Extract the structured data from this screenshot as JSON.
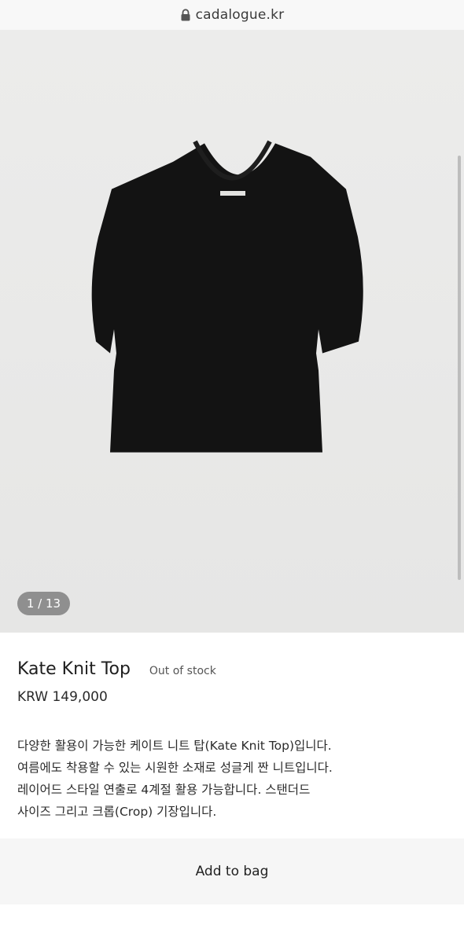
{
  "browser": {
    "url": "cadalogue.kr",
    "icon": "lock-icon"
  },
  "gallery": {
    "counter": "1 / 13"
  },
  "product": {
    "name": "Kate Knit Top",
    "stock_status": "Out of stock",
    "price": "KRW 149,000",
    "description": [
      "다양한 활용이 가능한 케이트 니트 탑(Kate Knit Top)입니다.",
      "여름에도 착용할 수 있는 시원한 소재로 성글게 짠 니트입니다.",
      "레이어드 스타일 연출로 4계절 활용 가능합니다. 스탠더드",
      "사이즈 그리고 크롭(Crop) 기장입니다."
    ]
  },
  "actions": {
    "add_to_bag": "Add to bag"
  }
}
